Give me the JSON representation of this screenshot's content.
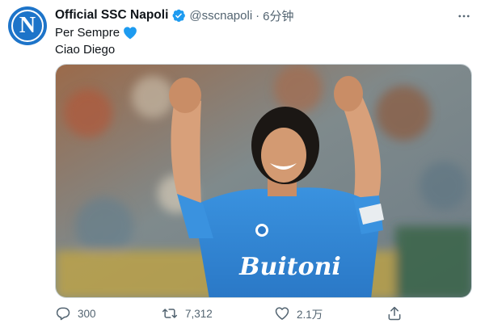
{
  "tweet": {
    "display_name": "Official SSC Napoli",
    "handle": "@sscnapoli",
    "separator": "·",
    "time": "6分钟",
    "lines": [
      "Per Sempre",
      "Ciao Diego"
    ],
    "avatar_letter": "N"
  },
  "photo": {
    "jersey_sponsor": "Buitoni",
    "jersey_color": "#2f86d6",
    "background_color": "#8a7a6a"
  },
  "actions": {
    "reply_count": "300",
    "retweet_count": "7,312",
    "like_count": "2.1万"
  },
  "colors": {
    "verified": "#1d9bf0",
    "heart": "#1d9bf0",
    "muted": "#536471",
    "avatar_bg": "#1d74c9"
  }
}
